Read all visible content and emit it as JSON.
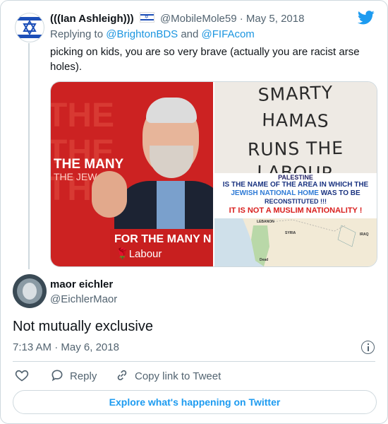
{
  "parent_tweet": {
    "display_name": "(((Ian Ashleigh)))",
    "handle": "@MobileMole59",
    "separator": "·",
    "date": "May 5, 2018",
    "replying_to_prefix": "Replying to",
    "replying_to_users": [
      "@BrightonBDS",
      "@FIFAcom"
    ],
    "replying_to_joiner": "and",
    "text": "picking on kids, you are so very brave (actually you are racist arse holes).",
    "images": {
      "image1": {
        "bg_text": "THE\nTHE\nTHE",
        "banner_line1": "THE MANY",
        "banner_line2": "THE JEW",
        "sign_line1": "FOR THE MANY N",
        "sign_line2": "Labour"
      },
      "image2": {
        "lines": [
          "SMARTY",
          "HAMAS",
          "RUNS THE",
          "LABOUR"
        ]
      },
      "image3": {
        "cut_line": "PALESTINE",
        "line1": "IS THE NAME OF THE AREA IN WHICH THE",
        "line2_highlight": "JEWISH NATIONAL HOME",
        "line2_rest": "WAS TO BE",
        "line3": "RECONSTITUTED !!!",
        "line4": "IT IS NOT A MUSLIM NATIONALITY !",
        "map_labels": [
          "LEBANON",
          "SYRIA",
          "IRAQ",
          "Dead"
        ]
      }
    }
  },
  "reply_tweet": {
    "display_name": "maor eichler",
    "handle": "@EichlerMaor",
    "text": "Not mutually exclusive",
    "time": "7:13 AM",
    "separator": "·",
    "date": "May 6, 2018"
  },
  "actions": {
    "reply_label": "Reply",
    "copy_link_label": "Copy link to Tweet"
  },
  "footer": {
    "explore_label": "Explore what's happening on Twitter"
  },
  "icons": {
    "brand": "twitter-bird-icon",
    "like": "heart-icon",
    "reply": "reply-bubble-icon",
    "copy": "link-icon",
    "info": "info-icon"
  },
  "colors": {
    "twitter_blue": "#1d9bf0",
    "link_blue": "#1b95e0",
    "text": "#0f1419",
    "muted": "#536471",
    "border": "#cfd9de"
  }
}
